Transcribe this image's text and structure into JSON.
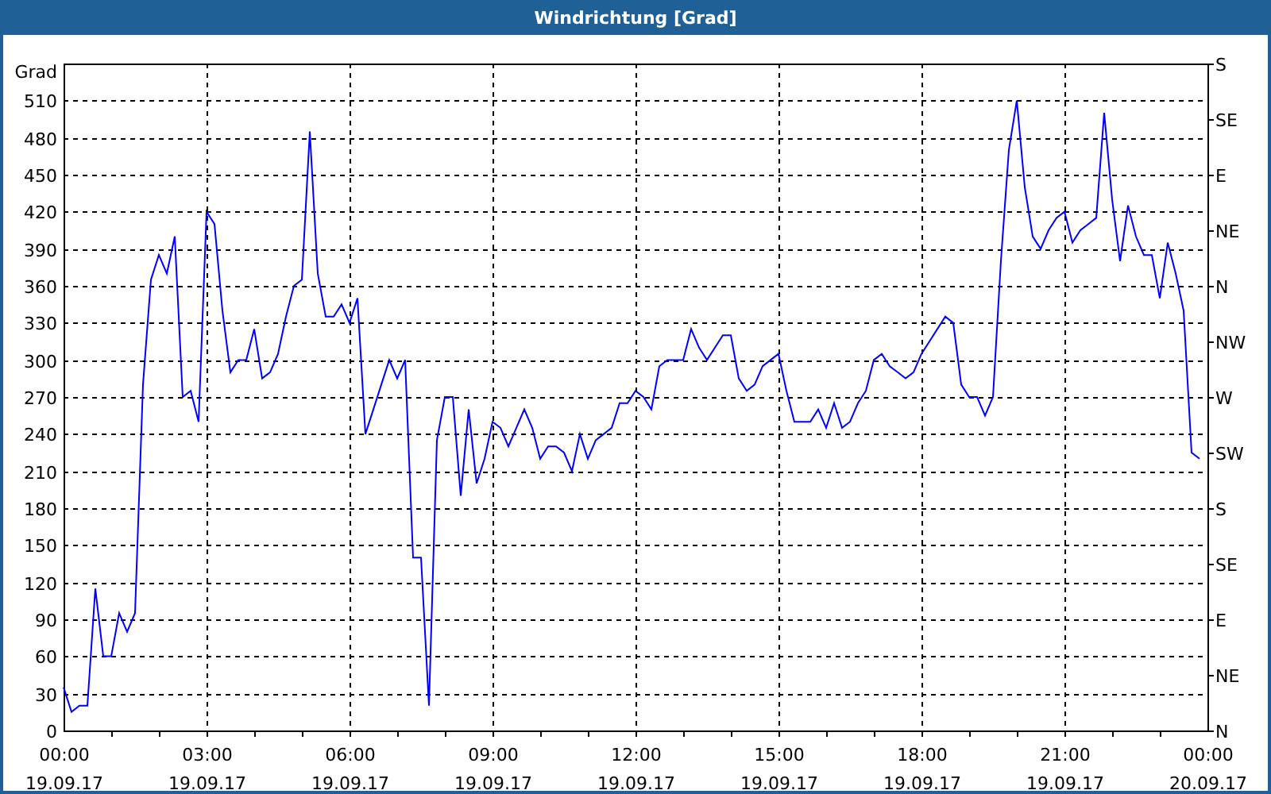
{
  "window": {
    "title": "Windrichtung [Grad]"
  },
  "chart": {
    "chart_data": {
      "type": "line",
      "grid": true,
      "ylabel": "Grad",
      "ylim": [
        0,
        540
      ],
      "categories": [
        "00:00\n19.09.17",
        null,
        null,
        null,
        null,
        null,
        null,
        null,
        null,
        null,
        null,
        null,
        null,
        null,
        null,
        null,
        null,
        null,
        "03:00\n19.09.17",
        null,
        null,
        null,
        null,
        null,
        null,
        null,
        null,
        null,
        null,
        null,
        null,
        null,
        null,
        null,
        null,
        null,
        "06:00\n19.09.17",
        null,
        null,
        null,
        null,
        null,
        null,
        null,
        null,
        null,
        null,
        null,
        null,
        null,
        null,
        null,
        null,
        null,
        "09:00\n19.09.17",
        null,
        null,
        null,
        null,
        null,
        null,
        null,
        null,
        null,
        null,
        null,
        null,
        null,
        null,
        null,
        null,
        null,
        "12:00\n19.09.17",
        null,
        null,
        null,
        null,
        null,
        null,
        null,
        null,
        null,
        null,
        null,
        null,
        null,
        null,
        null,
        null,
        null,
        "15:00\n19.09.17",
        null,
        null,
        null,
        null,
        null,
        null,
        null,
        null,
        null,
        null,
        null,
        null,
        null,
        null,
        null,
        null,
        null,
        "18:00\n19.09.17",
        null,
        null,
        null,
        null,
        null,
        null,
        null,
        null,
        null,
        null,
        null,
        null,
        null,
        null,
        null,
        null,
        null,
        "21:00\n19.09.17",
        null,
        null,
        null,
        null,
        null,
        null,
        null,
        null,
        null,
        null,
        null,
        null,
        null,
        null,
        null,
        null,
        null,
        "00:00\n20.09.17"
      ],
      "series": [
        {
          "color": "#0000ff",
          "values": [
            35,
            15,
            20,
            20,
            115,
            60,
            60,
            95,
            80,
            95,
            280,
            365,
            385,
            370,
            400,
            270,
            275,
            250,
            420,
            410,
            340,
            290,
            300,
            300,
            325,
            285,
            290,
            305,
            335,
            360,
            365,
            485,
            370,
            335,
            335,
            345,
            330,
            350,
            240,
            260,
            280,
            300,
            285,
            300,
            140,
            140,
            20,
            235,
            270,
            270,
            190,
            260,
            200,
            220,
            250,
            245,
            230,
            245,
            260,
            245,
            220,
            230,
            230,
            225,
            210,
            240,
            220,
            235,
            240,
            245,
            265,
            265,
            275,
            270,
            260,
            295,
            300,
            300,
            300,
            325,
            310,
            300,
            310,
            320,
            320,
            285,
            275,
            280,
            295,
            300,
            305,
            275,
            250,
            250,
            250,
            260,
            245,
            265,
            245,
            250,
            265,
            275,
            300,
            305,
            295,
            290,
            285,
            290,
            305,
            315,
            325,
            335,
            330,
            280,
            270,
            270,
            255,
            270,
            380,
            470,
            510,
            440,
            400,
            390,
            405,
            415,
            420,
            395,
            405,
            410,
            415,
            500,
            430,
            380,
            425,
            400,
            385,
            385,
            350,
            395,
            370,
            340,
            225,
            220,
            null
          ]
        }
      ],
      "yticks": [
        0,
        30,
        60,
        90,
        120,
        150,
        180,
        210,
        240,
        270,
        300,
        330,
        360,
        390,
        420,
        450,
        480,
        510
      ]
    },
    "right_axis_labels": [
      "S",
      "SE",
      "E",
      "NE",
      "N",
      "NW",
      "W",
      "SW",
      "S",
      "SE",
      "E",
      "NE",
      "N"
    ]
  }
}
